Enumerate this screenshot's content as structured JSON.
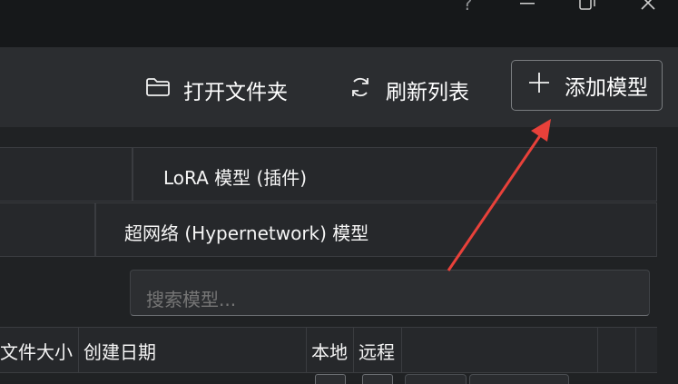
{
  "window": {
    "controls": {
      "help": "?"
    }
  },
  "toolbar": {
    "open_folder_label": "打开文件夹",
    "refresh_label": "刷新列表",
    "add_model_label": "添加模型"
  },
  "tabs": {
    "lora": "LoRA 模型 (插件)",
    "hypernetwork": "超网络 (Hypernetwork) 模型"
  },
  "search": {
    "placeholder": "搜索模型..."
  },
  "table": {
    "columns": [
      "文件大小",
      "创建日期",
      "本地",
      "远程"
    ]
  },
  "annotation": {
    "arrow_color": "#e8413a"
  },
  "colors": {
    "accent_border": "#7a7d80",
    "background": "#202224"
  }
}
